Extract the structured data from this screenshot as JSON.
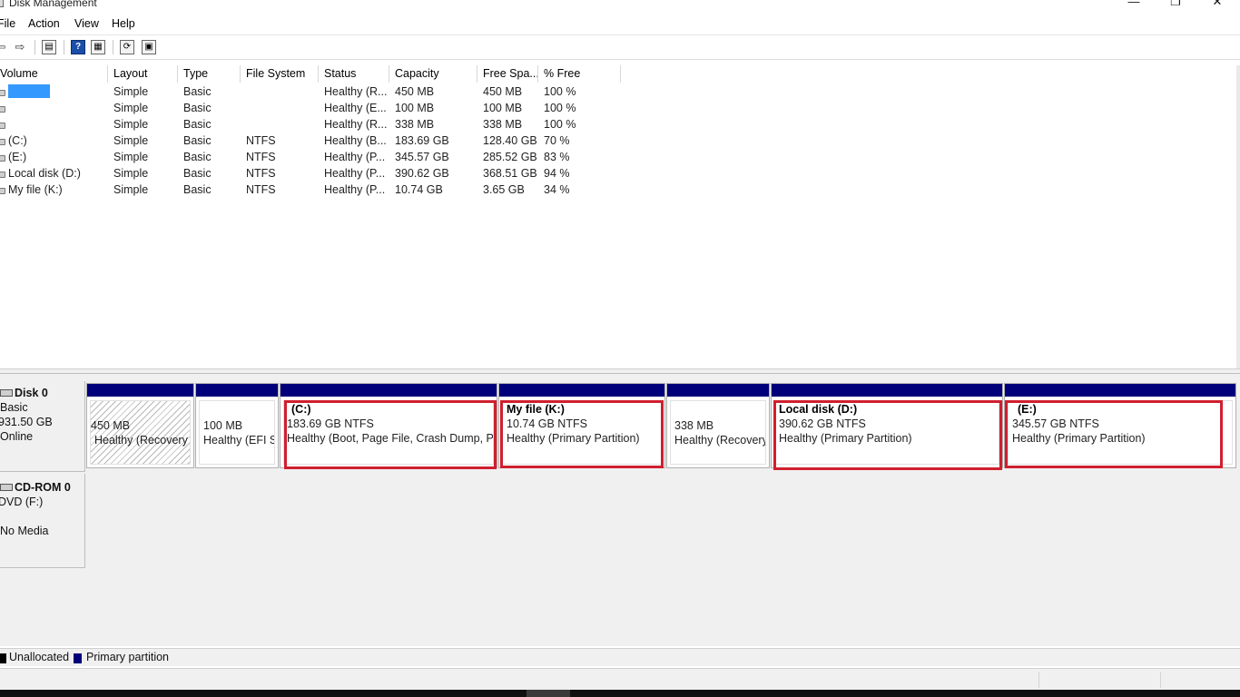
{
  "window": {
    "title": "Disk Management",
    "minimize": "—",
    "maximize": "❐",
    "close": "✕"
  },
  "menu": [
    "File",
    "Action",
    "View",
    "Help"
  ],
  "toolbar": {
    "back": "⇦",
    "forward": "⇨",
    "props": "▤",
    "help": "?",
    "view": "▦",
    "refresh": "⟳",
    "settings": "▣"
  },
  "columns": [
    "Volume",
    "Layout",
    "Type",
    "File System",
    "Status",
    "Capacity",
    "Free Spa...",
    "% Free"
  ],
  "volumes": [
    {
      "volume": "",
      "layout": "Simple",
      "type": "Basic",
      "fs": "",
      "status": "Healthy (R...",
      "capacity": "450 MB",
      "free": "450 MB",
      "pct": "100 %",
      "selected": true
    },
    {
      "volume": "",
      "layout": "Simple",
      "type": "Basic",
      "fs": "",
      "status": "Healthy (E...",
      "capacity": "100 MB",
      "free": "100 MB",
      "pct": "100 %"
    },
    {
      "volume": "",
      "layout": "Simple",
      "type": "Basic",
      "fs": "",
      "status": "Healthy (R...",
      "capacity": "338 MB",
      "free": "338 MB",
      "pct": "100 %"
    },
    {
      "volume": "(C:)",
      "layout": "Simple",
      "type": "Basic",
      "fs": "NTFS",
      "status": "Healthy (B...",
      "capacity": "183.69 GB",
      "free": "128.40 GB",
      "pct": "70 %"
    },
    {
      "volume": "(E:)",
      "layout": "Simple",
      "type": "Basic",
      "fs": "NTFS",
      "status": "Healthy (P...",
      "capacity": "345.57 GB",
      "free": "285.52 GB",
      "pct": "83 %"
    },
    {
      "volume": "Local disk (D:)",
      "layout": "Simple",
      "type": "Basic",
      "fs": "NTFS",
      "status": "Healthy (P...",
      "capacity": "390.62 GB",
      "free": "368.51 GB",
      "pct": "94 %"
    },
    {
      "volume": "My file (K:)",
      "layout": "Simple",
      "type": "Basic",
      "fs": "NTFS",
      "status": "Healthy (P...",
      "capacity": "10.74 GB",
      "free": "3.65 GB",
      "pct": "34 %"
    }
  ],
  "disk0": {
    "name": "Disk 0",
    "kind": "Basic",
    "size": "931.50 GB",
    "state": "Online",
    "partitions": [
      {
        "name": "",
        "size": "450 MB",
        "status": "Healthy (Recovery P",
        "hatched": true
      },
      {
        "name": "",
        "size": "100 MB",
        "status": "Healthy (EFI Sy"
      },
      {
        "name": "(C:)",
        "size": "183.69 GB NTFS",
        "status": "Healthy (Boot, Page File, Crash Dump, Prir",
        "highlight": true
      },
      {
        "name": "My file  (K:)",
        "size": "10.74 GB NTFS",
        "status": "Healthy (Primary Partition)",
        "highlight": true
      },
      {
        "name": "",
        "size": "338 MB",
        "status": "Healthy (Recovery"
      },
      {
        "name": "Local disk  (D:)",
        "size": "390.62 GB NTFS",
        "status": "Healthy (Primary Partition)",
        "highlight": true
      },
      {
        "name": "(E:)",
        "size": "345.57 GB NTFS",
        "status": "Healthy (Primary Partition)",
        "highlight": true
      }
    ]
  },
  "cdrom": {
    "name": "CD-ROM 0",
    "drive": "DVD (F:)",
    "media": "No Media"
  },
  "legend": [
    {
      "label": "Unallocated",
      "color": "#000000"
    },
    {
      "label": "Primary partition",
      "color": "#00007a"
    }
  ],
  "colors": {
    "primary_bar": "#00007a",
    "highlight": "#d01f2f",
    "selection": "#3399ff"
  }
}
